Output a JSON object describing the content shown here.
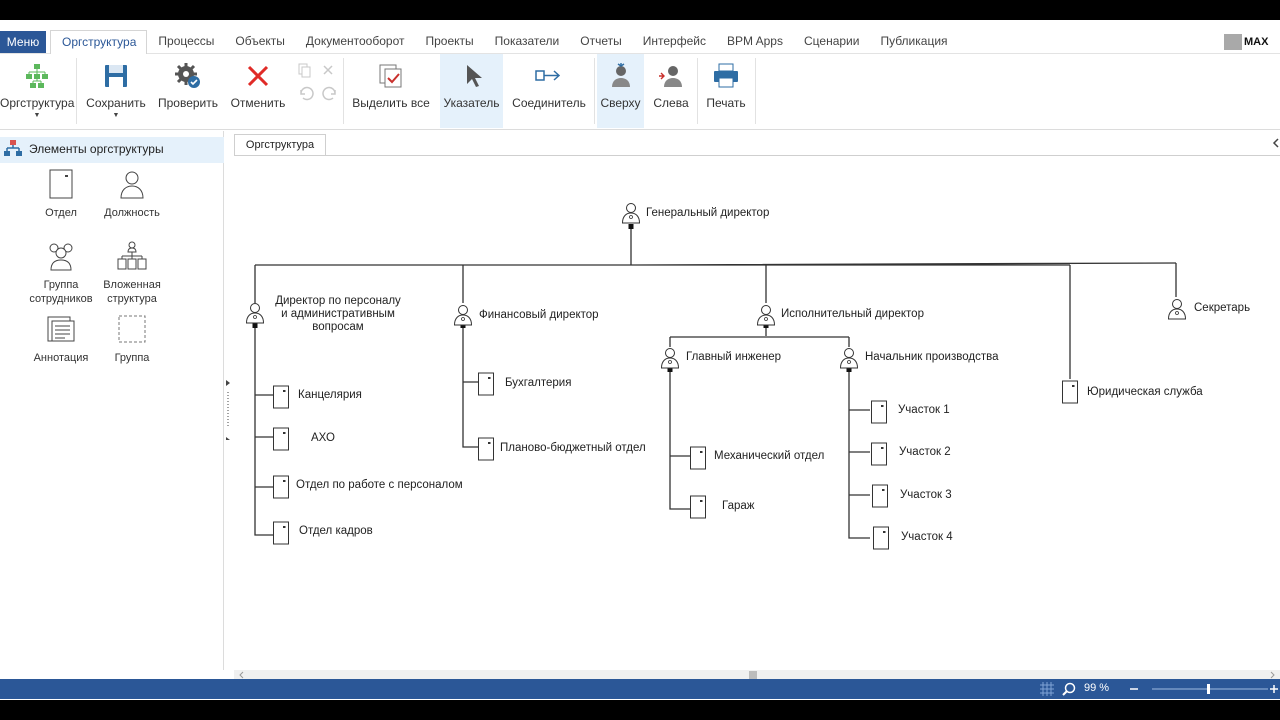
{
  "menu": {
    "label": "Меню"
  },
  "tabs": [
    {
      "label": "Оргструктура",
      "active": true
    },
    {
      "label": "Процессы"
    },
    {
      "label": "Объекты"
    },
    {
      "label": "Документооборот"
    },
    {
      "label": "Проекты"
    },
    {
      "label": "Показатели"
    },
    {
      "label": "Отчеты"
    },
    {
      "label": "Интерфейс"
    },
    {
      "label": "BPM Apps"
    },
    {
      "label": "Сценарии"
    },
    {
      "label": "Публикация"
    }
  ],
  "logo": {
    "text": "MAX"
  },
  "ribbon": {
    "orgstructure": "Оргструктура",
    "save": "Сохранить",
    "check": "Проверить",
    "cancel": "Отменить",
    "select_all": "Выделить все",
    "pointer": "Указатель",
    "connector": "Соединитель",
    "top": "Сверху",
    "left": "Слева",
    "print": "Печать"
  },
  "left_panel": {
    "title": "Элементы оргструктуры",
    "items": [
      {
        "label": "Отдел"
      },
      {
        "label": "Должность"
      },
      {
        "label": "Группа сотрудников"
      },
      {
        "label": "Вложенная структура"
      },
      {
        "label": "Аннотация"
      },
      {
        "label": "Группа"
      }
    ]
  },
  "doc_tab": {
    "label": "Оргструктура"
  },
  "org": {
    "general_director": "Генеральный директор",
    "hr_director": [
      "Директор по персоналу",
      "и административным",
      "вопросам"
    ],
    "finance_director": "Финансовый директор",
    "exec_director": "Исполнительный директор",
    "secretary": "Секретарь",
    "chief_engineer": "Главный инженер",
    "production_head": "Начальник производства",
    "legal": "Юридическая служба",
    "chancellery": "Канцелярия",
    "aho": "АХО",
    "hr_dept": "Отдел по работе с персоналом",
    "personnel_dept": "Отдел кадров",
    "accounting": "Бухгалтерия",
    "planning": "Планово-бюджетный отдел",
    "mechanical": "Механический отдел",
    "garage": "Гараж",
    "site1": "Участок 1",
    "site2": "Участок 2",
    "site3": "Участок 3",
    "site4": "Участок 4"
  },
  "status": {
    "zoom": "99 %"
  },
  "colors": {
    "accent": "#2b5797",
    "selected": "#e5f1fb"
  }
}
